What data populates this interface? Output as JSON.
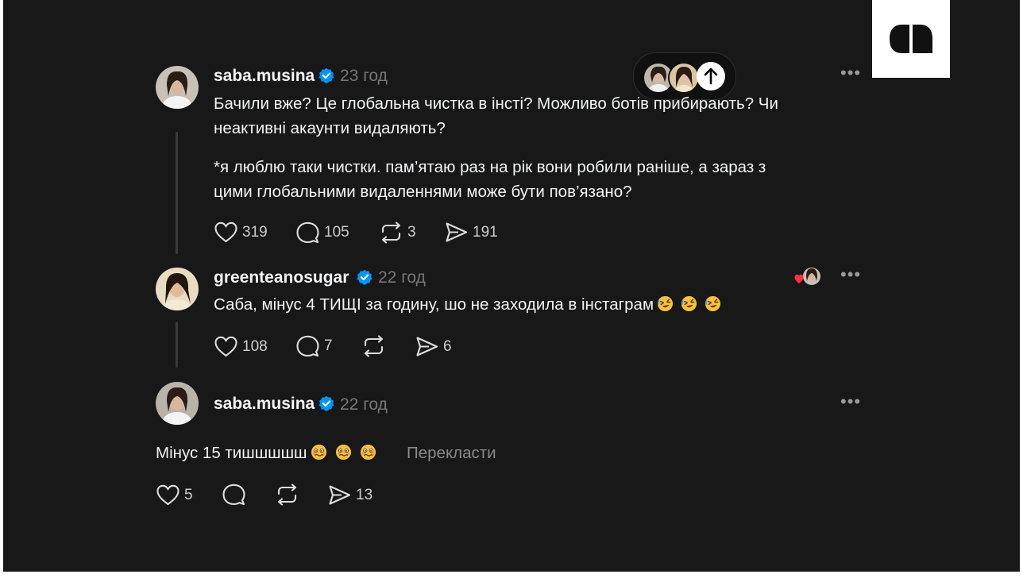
{
  "scroll_pill": {
    "up_icon": "arrow-up-icon"
  },
  "posts": [
    {
      "username": "saba.musina",
      "time": "23 год",
      "text_line1": "Бачили вже? Це глобальна чистка в інсті? Можливо ботів прибирають? Чи",
      "text_line2": "неактивні акаунти видаляють?",
      "text_line3": "*я люблю таки чистки. пам’ятаю раз на рік вони робили раніше, а зараз з",
      "text_line4": "цими глобальними видаленнями може бути пов’язано?",
      "likes": "319",
      "comments": "105",
      "reposts": "3",
      "shares": "191"
    },
    {
      "username": "greenteanosugar",
      "time": "22 год",
      "text_line1": "Саба, мінус 4 ТИЩІ за годину, шо не заходила в інстаграм",
      "likes": "108",
      "comments": "7",
      "reposts": "",
      "shares": "6"
    },
    {
      "username": "saba.musina",
      "time": "22 год",
      "text_line1": "Мінус 15 тишшшшш",
      "translate": "Перекласти",
      "likes": "5",
      "comments": "",
      "reposts": "",
      "shares": "13"
    }
  ],
  "colors": {
    "background": "#181818",
    "text": "#f3f5f7",
    "muted": "#777777",
    "verified": "#0095f6",
    "like_heart": "#ff3040"
  }
}
